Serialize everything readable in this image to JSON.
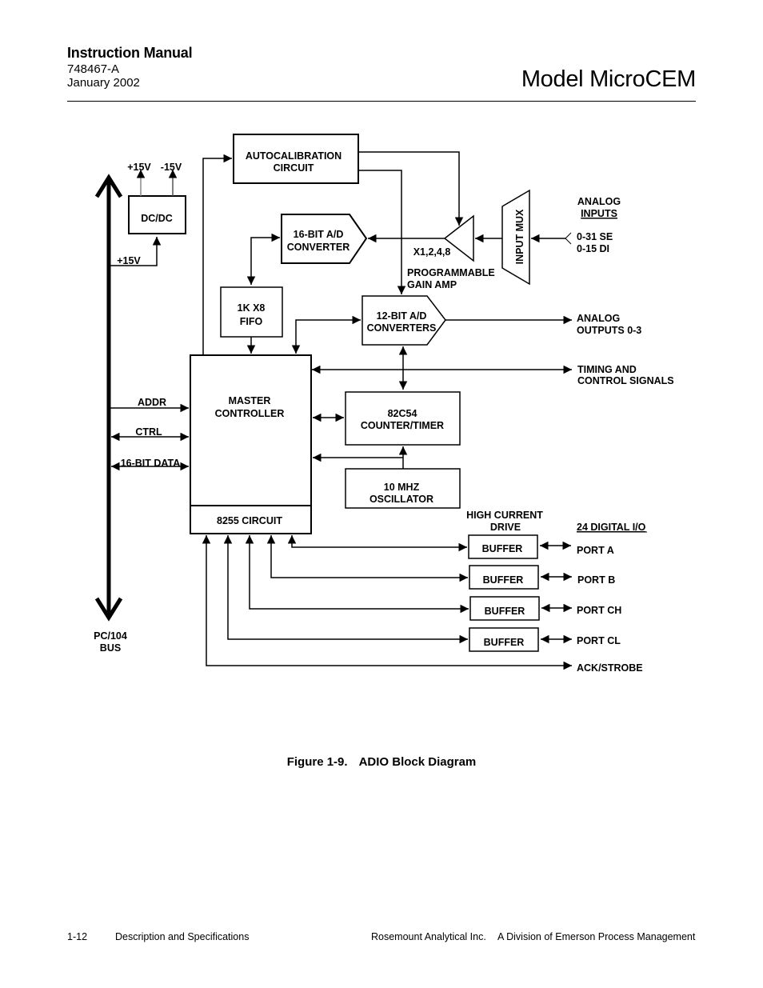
{
  "header": {
    "manual_title": "Instruction Manual",
    "doc_number": "748467-A",
    "date": "January 2002",
    "model": "Model MicroCEM"
  },
  "diagram": {
    "bus": {
      "label_line1": "PC/104",
      "label_line2": "BUS"
    },
    "bus_signals": {
      "addr": "ADDR",
      "ctrl": "CTRL",
      "data": "16-BIT DATA"
    },
    "dcdc": {
      "label": "DC/DC",
      "out_pos": "+15V",
      "out_neg": "-15V",
      "in": "+15V"
    },
    "autocal": {
      "line1": "AUTOCALIBRATION",
      "line2": "CIRCUIT"
    },
    "adc16": {
      "line1": "16-BIT A/D",
      "line2": "CONVERTER"
    },
    "fifo": {
      "line1": "1K X8",
      "line2": "FIFO"
    },
    "pga": {
      "gain": "X1,2,4,8",
      "line1": "PROGRAMMABLE",
      "line2": "GAIN AMP"
    },
    "mux": {
      "label": "INPUT MUX"
    },
    "analog_inputs": {
      "title1": "ANALOG",
      "title2": "INPUTS",
      "line1": "0-31 SE",
      "line2": "0-15 DI"
    },
    "adc12": {
      "line1": "12-BIT A/D",
      "line2": "CONVERTERS"
    },
    "analog_outputs": {
      "line1": "ANALOG",
      "line2": "OUTPUTS 0-3"
    },
    "timing": {
      "line1": "TIMING AND",
      "line2": "CONTROL SIGNALS"
    },
    "master": {
      "line1": "MASTER",
      "line2": "CONTROLLER"
    },
    "circuit8255": {
      "label": "8255 CIRCUIT"
    },
    "counter": {
      "line1": "82C54",
      "line2": "COUNTER/TIMER"
    },
    "oscillator": {
      "line1": "10 MHZ",
      "line2": "OSCILLATOR"
    },
    "drive": {
      "line1": "HIGH CURRENT",
      "line2": "DRIVE"
    },
    "digital_io_title": "24 DIGITAL I/O",
    "buffers": [
      {
        "label": "BUFFER",
        "port": "PORT A"
      },
      {
        "label": "BUFFER",
        "port": "PORT B"
      },
      {
        "label": "BUFFER",
        "port": "PORT CH"
      },
      {
        "label": "BUFFER",
        "port": "PORT CL"
      }
    ],
    "ack_strobe": "ACK/STROBE"
  },
  "caption": {
    "number": "Figure 1-9.",
    "title": "ADIO Block Diagram"
  },
  "footer": {
    "page": "1-12",
    "section": "Description and Specifications",
    "company": "Rosemount Analytical Inc.",
    "division": "A Division of Emerson Process Management"
  }
}
